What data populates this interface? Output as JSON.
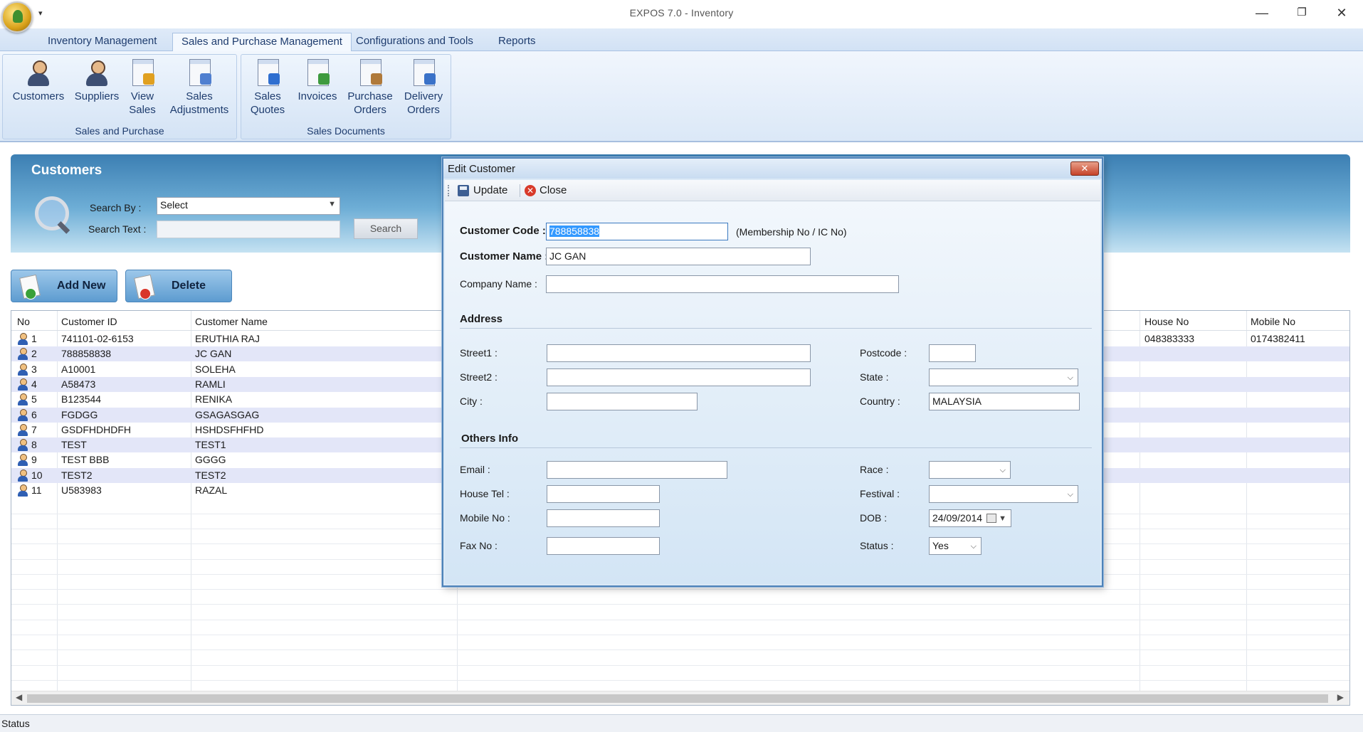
{
  "window": {
    "title": "EXPOS 7.0 - Inventory",
    "minimize": "—",
    "restore": "❐",
    "close": "✕"
  },
  "ribbon": {
    "tabs": [
      {
        "label": "Inventory Management"
      },
      {
        "label": "Sales and Purchase Management"
      },
      {
        "label": "Configurations and Tools"
      },
      {
        "label": "Reports"
      }
    ],
    "groups": {
      "sales_purchase": {
        "label": "Sales and Purchase",
        "buttons": [
          "Customers",
          "Suppliers",
          "View Sales",
          "Sales Adjustments"
        ]
      },
      "sales_documents": {
        "label": "Sales Documents",
        "buttons": [
          "Sales Quotes",
          "Invoices",
          "Purchase Orders",
          "Delivery Orders"
        ]
      }
    }
  },
  "customers_panel": {
    "title": "Customers",
    "search_by_label": "Search By :",
    "search_by_value": "Select",
    "search_text_label": "Search Text :",
    "search_text_value": "",
    "search_button": "Search",
    "add_new_button": "Add New",
    "delete_button": "Delete"
  },
  "grid": {
    "columns": [
      "No",
      "Customer ID",
      "Customer Name",
      "House No",
      "Mobile No"
    ],
    "rows": [
      {
        "no": "1",
        "id": "741101-02-6153",
        "name": "ERUTHIA RAJ",
        "house": "048383333",
        "mobile": "0174382411"
      },
      {
        "no": "2",
        "id": "788858838",
        "name": "JC GAN",
        "house": "",
        "mobile": ""
      },
      {
        "no": "3",
        "id": "A10001",
        "name": "SOLEHA",
        "house": "",
        "mobile": ""
      },
      {
        "no": "4",
        "id": "A58473",
        "name": "RAMLI",
        "house": "",
        "mobile": ""
      },
      {
        "no": "5",
        "id": "B123544",
        "name": "RENIKA",
        "house": "",
        "mobile": ""
      },
      {
        "no": "6",
        "id": "FGDGG",
        "name": "GSAGASGAG",
        "house": "",
        "mobile": ""
      },
      {
        "no": "7",
        "id": "GSDFHDHDFH",
        "name": "HSHDSFHFHD",
        "house": "",
        "mobile": ""
      },
      {
        "no": "8",
        "id": "TEST",
        "name": "TEST1",
        "house": "",
        "mobile": ""
      },
      {
        "no": "9",
        "id": "TEST BBB",
        "name": "GGGG",
        "house": "",
        "mobile": ""
      },
      {
        "no": "10",
        "id": "TEST2",
        "name": "TEST2",
        "house": "",
        "mobile": ""
      },
      {
        "no": "11",
        "id": "U583983",
        "name": "RAZAL",
        "house": "",
        "mobile": ""
      }
    ]
  },
  "status_bar": {
    "text": "Status"
  },
  "dialog": {
    "title": "Edit Customer",
    "close_x": "✕",
    "toolbar": {
      "update": "Update",
      "close": "Close"
    },
    "customer_code_label": "Customer Code :",
    "customer_code_value": "788858838",
    "customer_code_hint": "(Membership No / IC No)",
    "customer_name_label": "Customer Name :",
    "customer_name_value": "JC GAN",
    "company_name_label": "Company Name :",
    "company_name_value": "",
    "address_section": "Address",
    "street1_label": "Street1 :",
    "street2_label": "Street2 :",
    "city_label": "City :",
    "postcode_label": "Postcode :",
    "state_label": "State :",
    "country_label": "Country :",
    "country_value": "MALAYSIA",
    "others_section": "Others Info",
    "email_label": "Email :",
    "house_tel_label": "House Tel :",
    "mobile_label": "Mobile No :",
    "fax_label": "Fax No :",
    "race_label": "Race :",
    "festival_label": "Festival :",
    "dob_label": "DOB :",
    "dob_value": "24/09/2014",
    "status_label": "Status :",
    "status_value": "Yes"
  }
}
